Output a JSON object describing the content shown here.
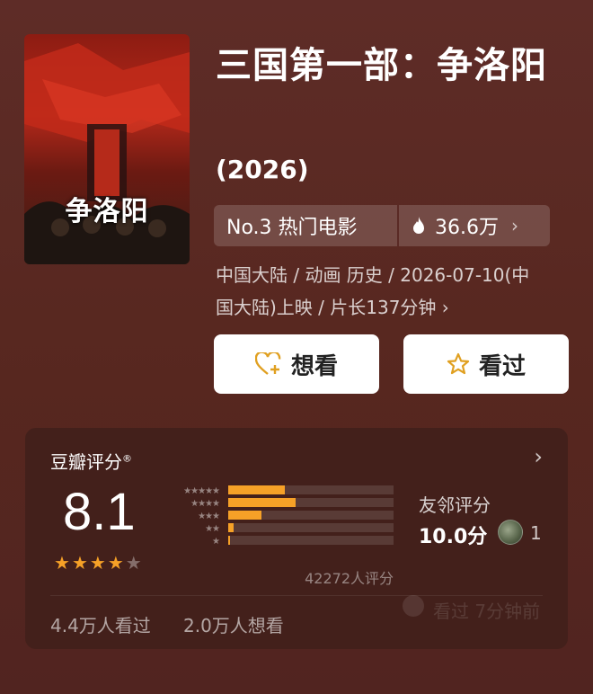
{
  "poster": {
    "image": "movie-poster",
    "title_text": "争洛阳"
  },
  "movie": {
    "title": "三国第一部：争洛阳",
    "year": "(2026)",
    "rank": "No.3 热门电影",
    "heat": "36.6万",
    "meta_line1": "中国大陆 / 动画 历史 / 2026-07-10(中",
    "meta_line2": "国大陆)上映 / 片长137分钟"
  },
  "actions": {
    "want": "想看",
    "seen": "看过"
  },
  "rating": {
    "label": "豆瓣评分",
    "score": "8.1",
    "stars_value": 4,
    "stars_max": 5,
    "distribution": [
      0.34,
      0.41,
      0.2,
      0.03,
      0.01
    ],
    "count": "42272人评分",
    "friend_label": "友邻评分",
    "friend_score": "10.0分",
    "friend_count": "1",
    "watched": "4.4万人看过",
    "wanted": "2.0万人想看",
    "watermark": "看过 7分钟前"
  },
  "colors": {
    "accent": "#f6a127",
    "background": "#5a2a25",
    "card": "#43201b"
  }
}
